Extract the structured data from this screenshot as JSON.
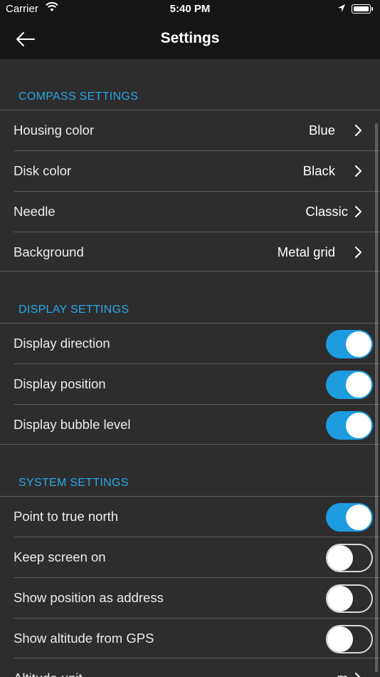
{
  "status_bar": {
    "carrier": "Carrier",
    "time": "5:40 PM"
  },
  "nav": {
    "title": "Settings"
  },
  "sections": {
    "compass": {
      "header": "COMPASS SETTINGS",
      "rows": [
        {
          "label": "Housing color",
          "value": "Blue"
        },
        {
          "label": "Disk color",
          "value": "Black"
        },
        {
          "label": "Needle",
          "value": "Classic"
        },
        {
          "label": "Background",
          "value": "Metal grid"
        }
      ]
    },
    "display": {
      "header": "DISPLAY SETTINGS",
      "rows": [
        {
          "label": "Display direction",
          "on": true
        },
        {
          "label": "Display position",
          "on": true
        },
        {
          "label": "Display bubble level",
          "on": true
        }
      ]
    },
    "system": {
      "header": "SYSTEM SETTINGS",
      "rows": [
        {
          "label": "Point to true north",
          "on": true
        },
        {
          "label": "Keep screen on",
          "on": false
        },
        {
          "label": "Show position as address",
          "on": false
        },
        {
          "label": "Show altitude from GPS",
          "on": false
        }
      ],
      "partial_row": {
        "label": "Altitude unit",
        "value": "m"
      }
    }
  },
  "colors": {
    "accent": "#1e9ce0",
    "section_header": "#2aa6e8",
    "background": "#2d2d2d",
    "bar": "#151515"
  }
}
